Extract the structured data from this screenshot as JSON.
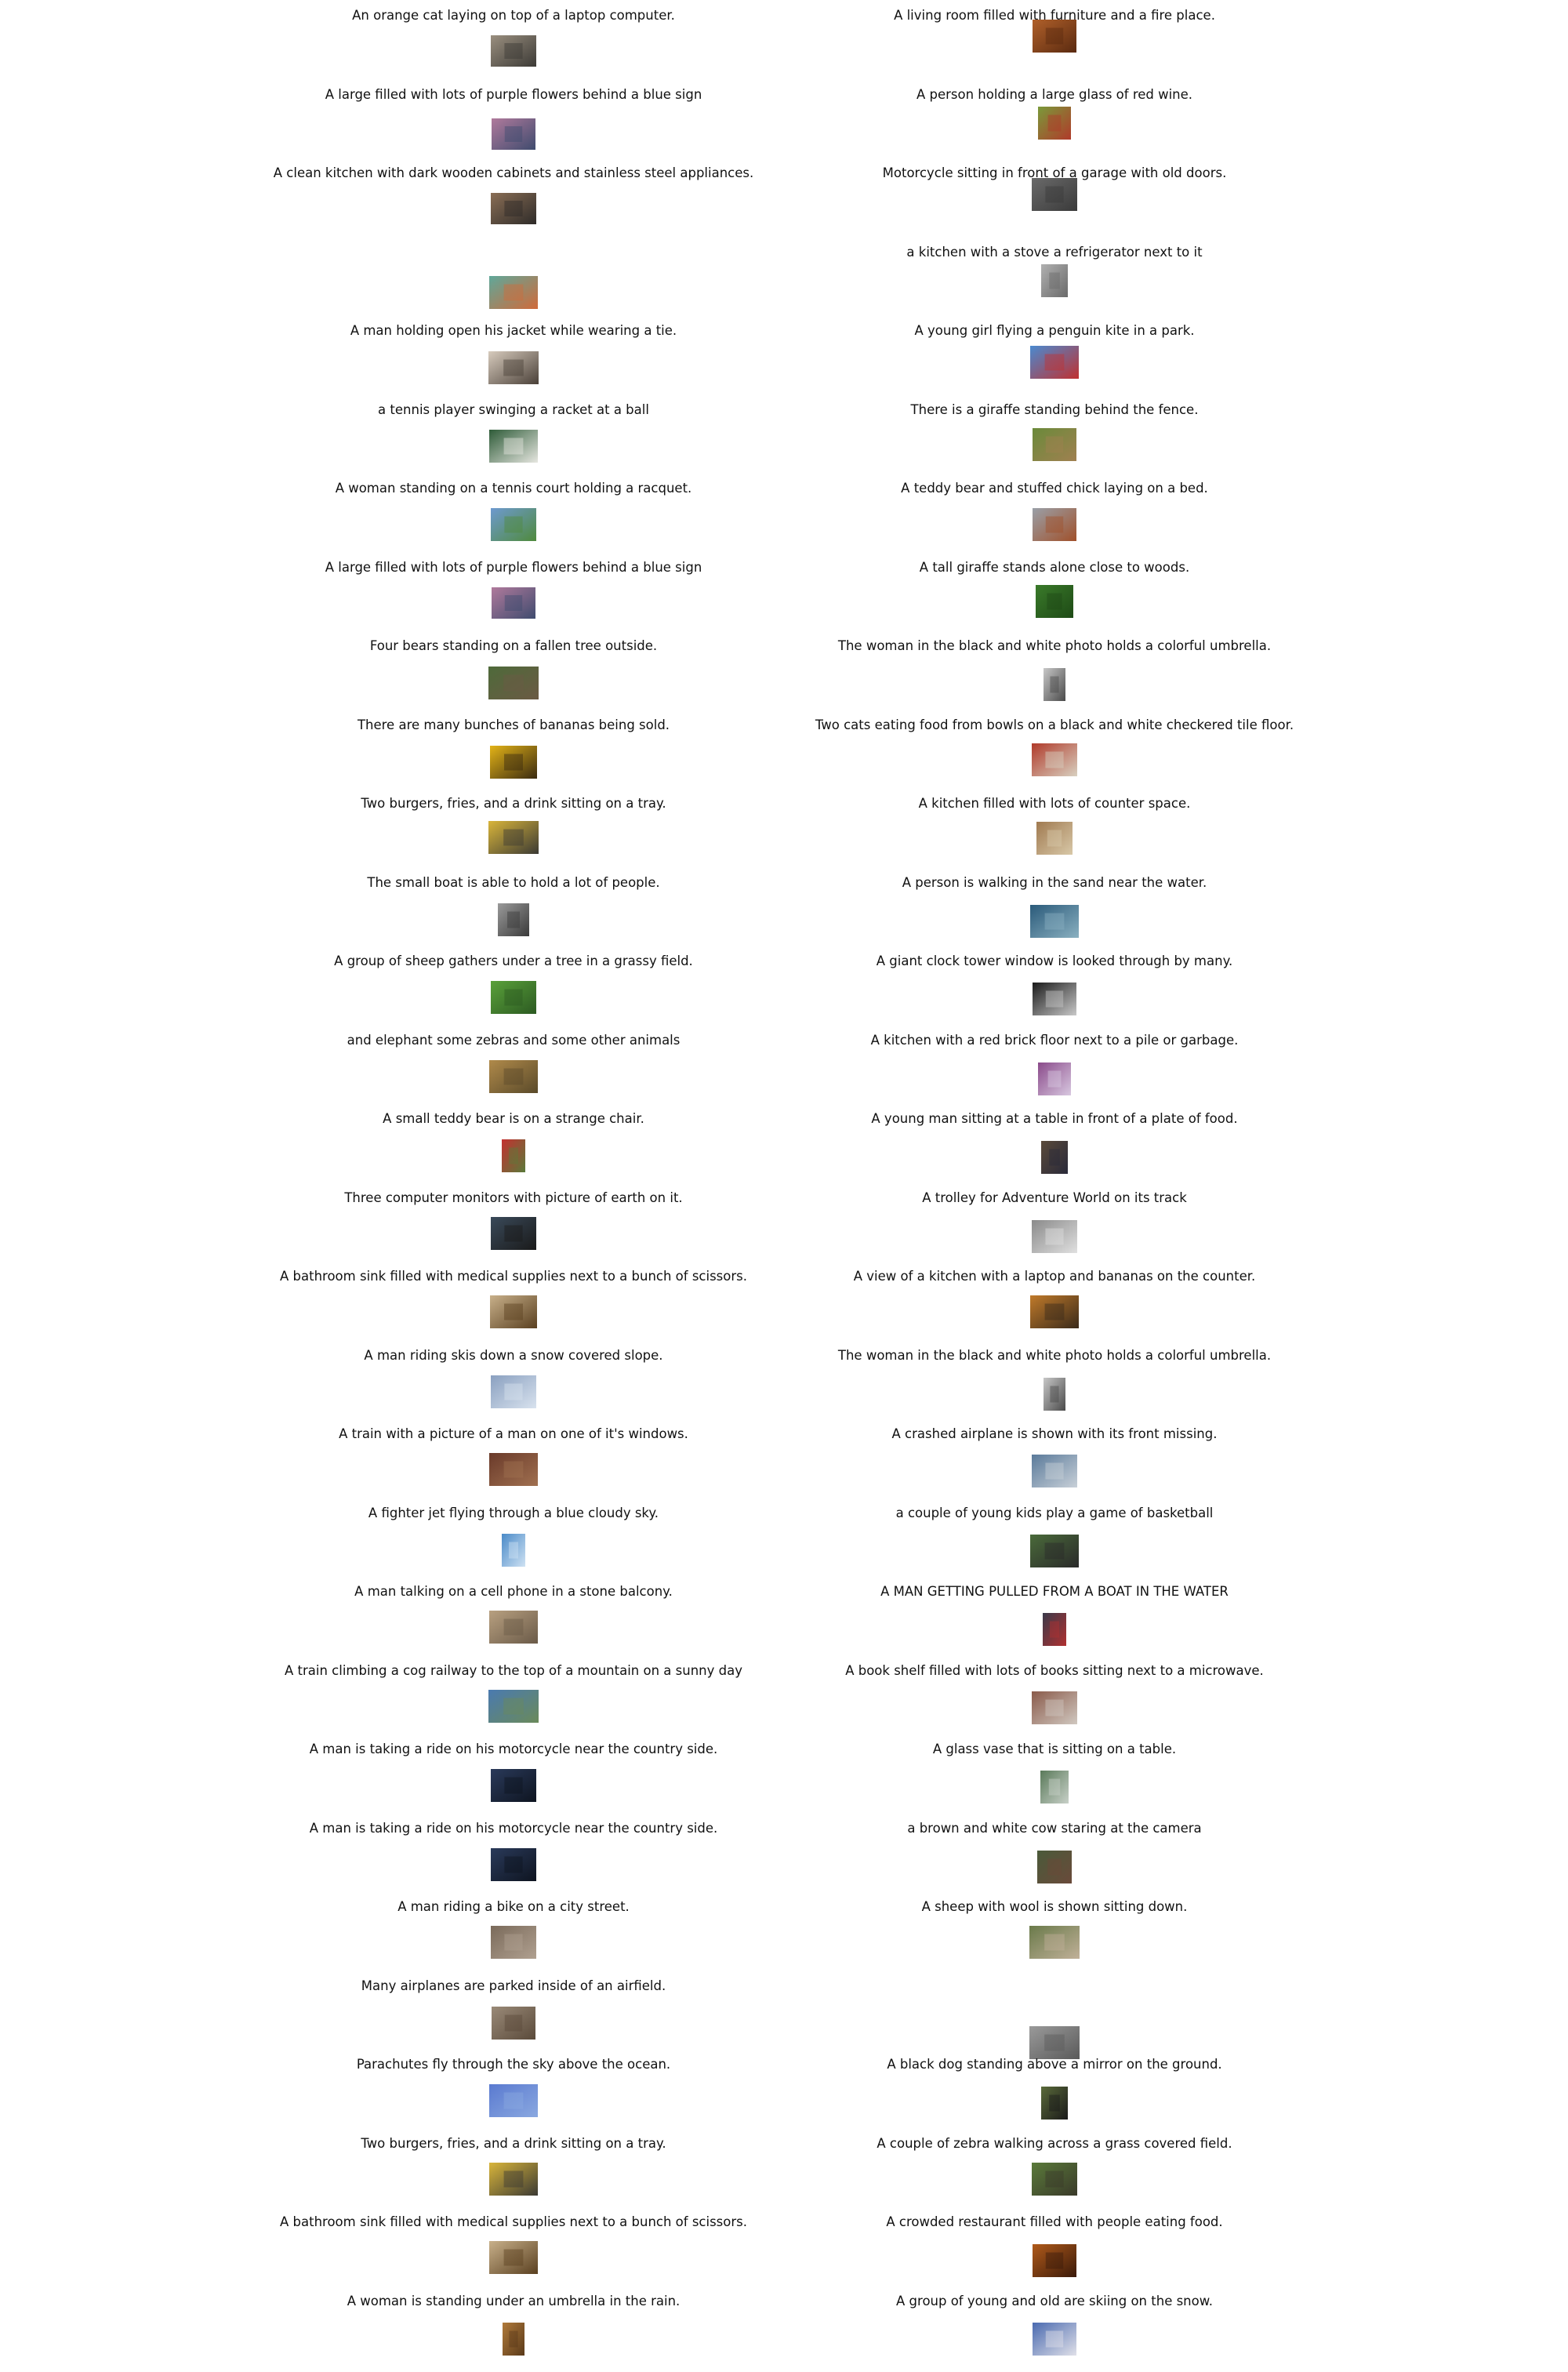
{
  "left_column": [
    {
      "caption": "An orange cat laying on top of a laptop computer.",
      "thumbnail": "cat-on-laptop",
      "colors": [
        "#9a8f7f",
        "#3c3a36"
      ]
    },
    {
      "caption": "A large filled with lots of purple flowers behind a blue sign",
      "thumbnail": "purple-flowers",
      "colors": [
        "#b07a9c",
        "#3f4b6e"
      ]
    },
    {
      "caption": "A clean kitchen with dark wooden cabinets and stainless steel appliances.",
      "thumbnail": "kitchen-cabinets",
      "colors": [
        "#8a6e55",
        "#2e2b29"
      ]
    },
    {
      "caption": "",
      "thumbnail": "person-orange-shirt",
      "colors": [
        "#5fa89a",
        "#d06a3a"
      ]
    },
    {
      "caption": "A man holding open his jacket while wearing a tie.",
      "thumbnail": "man-jacket-tie",
      "colors": [
        "#d7cbbd",
        "#4a4038"
      ]
    },
    {
      "caption": "a tennis player swinging a racket at a ball",
      "thumbnail": "tennis-player",
      "colors": [
        "#2e5b38",
        "#e6e6e0"
      ]
    },
    {
      "caption": "A woman standing on a tennis court holding a racquet.",
      "thumbnail": "woman-tennis-court",
      "colors": [
        "#6e9ad0",
        "#4f8a3c"
      ]
    },
    {
      "caption": "A large filled with lots of purple flowers behind a blue sign",
      "thumbnail": "purple-flowers",
      "colors": [
        "#b07a9c",
        "#3f4b6e"
      ]
    },
    {
      "caption": "Four bears standing on a fallen tree outside.",
      "thumbnail": "bears-on-tree",
      "colors": [
        "#4e6a3a",
        "#6b5a44"
      ]
    },
    {
      "caption": "There are many bunches of bananas being sold.",
      "thumbnail": "bananas",
      "colors": [
        "#e3b317",
        "#3a2a10"
      ]
    },
    {
      "caption": "Two burgers, fries, and a drink sitting on a tray.",
      "thumbnail": "burgers-tray",
      "colors": [
        "#d9b53a",
        "#3b3a34"
      ]
    },
    {
      "caption": "The small boat is able to hold a lot of people.",
      "thumbnail": "small-boat",
      "colors": [
        "#9a9a9a",
        "#3a3a3a"
      ]
    },
    {
      "caption": "A group of sheep gathers under a tree in a grassy field.",
      "thumbnail": "sheep-tree",
      "colors": [
        "#5aa13a",
        "#2c5a22"
      ]
    },
    {
      "caption": "and elephant some zebras and some other animals",
      "thumbnail": "elephant-zebras",
      "colors": [
        "#b08a4a",
        "#5a4a2a"
      ]
    },
    {
      "caption": "A small teddy bear is on a strange chair.",
      "thumbnail": "teddy-bear-chair",
      "colors": [
        "#c43030",
        "#5a7a3a"
      ]
    },
    {
      "caption": "Three computer monitors with picture of earth on it.",
      "thumbnail": "computer-monitors",
      "colors": [
        "#3a4a5a",
        "#1a1a1a"
      ]
    },
    {
      "caption": "A bathroom sink filled with medical supplies next to a bunch of scissors.",
      "thumbnail": "bathroom-sink",
      "colors": [
        "#c8b08a",
        "#5a4020"
      ]
    },
    {
      "caption": "A man riding skis down a snow covered slope.",
      "thumbnail": "man-skiing",
      "colors": [
        "#8aa0c0",
        "#d8e2ee"
      ]
    },
    {
      "caption": "A train with a picture of a man on one of it's windows.",
      "thumbnail": "train-window",
      "colors": [
        "#6a3a2a",
        "#a07050"
      ]
    },
    {
      "caption": "A fighter jet flying through a blue cloudy sky.",
      "thumbnail": "fighter-jet",
      "colors": [
        "#4a8ac8",
        "#cfe2f3"
      ]
    },
    {
      "caption": "A man talking on a cell phone in a stone balcony.",
      "thumbnail": "man-balcony",
      "colors": [
        "#b8a080",
        "#6a5a48"
      ]
    },
    {
      "caption": "A train climbing a cog railway to the top of a mountain on a sunny day",
      "thumbnail": "cog-railway",
      "colors": [
        "#4a7ab0",
        "#6a8a5a"
      ]
    },
    {
      "caption": "A man is taking a ride on his motorcycle near the country side.",
      "thumbnail": "motorcycle-country",
      "colors": [
        "#2a3a5a",
        "#0e1420"
      ]
    },
    {
      "caption": "A man is taking a ride on his motorcycle near the country side.",
      "thumbnail": "motorcycle-country",
      "colors": [
        "#2a3a5a",
        "#0e1420"
      ]
    },
    {
      "caption": "A man riding a bike on a city street.",
      "thumbnail": "bike-city-street",
      "colors": [
        "#7a6a5a",
        "#b0a090"
      ]
    },
    {
      "caption": "Many airplanes are parked inside of an airfield.",
      "thumbnail": "airplanes-airfield",
      "colors": [
        "#9a8a78",
        "#5a4a3a"
      ]
    },
    {
      "caption": "Parachutes fly through the sky above the ocean.",
      "thumbnail": "parachutes",
      "colors": [
        "#5a7ad0",
        "#8aa8e0"
      ]
    },
    {
      "caption": "Two burgers, fries, and a drink sitting on a tray.",
      "thumbnail": "burgers-tray",
      "colors": [
        "#d9b53a",
        "#3b3a34"
      ]
    },
    {
      "caption": "A bathroom sink filled with medical supplies next to a bunch of scissors.",
      "thumbnail": "bathroom-sink",
      "colors": [
        "#c8b08a",
        "#5a4020"
      ]
    },
    {
      "caption": "A woman is standing under an umbrella in the rain.",
      "thumbnail": "umbrella-rain",
      "colors": [
        "#b07a3a",
        "#5a3a1a"
      ]
    }
  ],
  "right_column": [
    {
      "caption": "A living room filled with furniture and a fire place.",
      "thumbnail": "living-room",
      "colors": [
        "#b0602a",
        "#5a2a10"
      ]
    },
    {
      "caption": "A person holding a large glass of red wine.",
      "thumbnail": "glass-red-wine",
      "colors": [
        "#7a9a3a",
        "#b03a2a"
      ]
    },
    {
      "caption": "Motorcycle sitting in front of a garage with old doors.",
      "thumbnail": "motorcycle-garage",
      "colors": [
        "#6a6a6a",
        "#3a3a3a"
      ]
    },
    {
      "caption": "a kitchen with a stove a refrigerator next to it",
      "thumbnail": "kitchen-refrigerator",
      "colors": [
        "#b0b0b0",
        "#6a6a6a"
      ]
    },
    {
      "caption": "A young girl flying a penguin kite in a park.",
      "thumbnail": "girl-penguin-kite",
      "colors": [
        "#4a8ad0",
        "#c03030"
      ]
    },
    {
      "caption": "There is a giraffe standing behind the fence.",
      "thumbnail": "giraffe-fence",
      "colors": [
        "#6a8a3a",
        "#a08050"
      ]
    },
    {
      "caption": "A teddy bear and stuffed chick laying on a bed.",
      "thumbnail": "teddy-bear-bed",
      "colors": [
        "#9aa0a8",
        "#a0502a"
      ]
    },
    {
      "caption": "A tall giraffe stands alone close to woods.",
      "thumbnail": "giraffe-woods",
      "colors": [
        "#3a7a2a",
        "#1e4a16"
      ]
    },
    {
      "caption": "The woman in the black and white photo holds a colorful umbrella.",
      "thumbnail": "bw-umbrella",
      "colors": [
        "#c8c8c8",
        "#4a4a4a"
      ]
    },
    {
      "caption": "Two cats eating food from bowls on a black and white checkered tile floor.",
      "thumbnail": "cats-eating",
      "colors": [
        "#b03a2a",
        "#d8d0c0"
      ]
    },
    {
      "caption": "A kitchen filled with lots of counter space.",
      "thumbnail": "kitchen-counter",
      "colors": [
        "#a07a50",
        "#d8c8a8"
      ]
    },
    {
      "caption": "A person is walking in the sand near the water.",
      "thumbnail": "sand-water",
      "colors": [
        "#2a5a7a",
        "#8ab0c0"
      ]
    },
    {
      "caption": "A giant clock tower window is looked through by many.",
      "thumbnail": "clock-tower-window",
      "colors": [
        "#1a1a1a",
        "#c8c8c8"
      ]
    },
    {
      "caption": "A kitchen with a red brick floor next to a pile or garbage.",
      "thumbnail": "red-brick-kitchen",
      "colors": [
        "#8a4a8a",
        "#d8c8e0"
      ]
    },
    {
      "caption": "A young man sitting at a table in front of a plate of food.",
      "thumbnail": "man-plate-food",
      "colors": [
        "#5a4a3a",
        "#2a2a3a"
      ]
    },
    {
      "caption": "A trolley for Adventure World on its track",
      "thumbnail": "trolley",
      "colors": [
        "#8a8a8a",
        "#e0e0e0"
      ]
    },
    {
      "caption": "A view of a kitchen with a laptop and bananas on the counter.",
      "thumbnail": "kitchen-laptop",
      "colors": [
        "#c07a2a",
        "#3a2a1a"
      ]
    },
    {
      "caption": "The woman in the black and white photo holds a colorful umbrella.",
      "thumbnail": "bw-umbrella",
      "colors": [
        "#c8c8c8",
        "#4a4a4a"
      ]
    },
    {
      "caption": "A crashed airplane is shown with its front missing.",
      "thumbnail": "crashed-airplane",
      "colors": [
        "#5a7a9a",
        "#c8d0d8"
      ]
    },
    {
      "caption": "a couple of young kids play a game of basketball",
      "thumbnail": "kids-basketball",
      "colors": [
        "#4a6a3a",
        "#2a2a2a"
      ]
    },
    {
      "caption": "A MAN GETTING PULLED FROM A BOAT IN THE WATER",
      "thumbnail": "man-boat-water",
      "colors": [
        "#3a3a4a",
        "#b03030"
      ]
    },
    {
      "caption": "A book shelf filled with lots of books sitting next to a microwave.",
      "thumbnail": "book-shelf",
      "colors": [
        "#8a5a4a",
        "#d0c8c0"
      ]
    },
    {
      "caption": "A glass vase that is sitting on a table.",
      "thumbnail": "glass-vase",
      "colors": [
        "#5a7a5a",
        "#c8d0c8"
      ]
    },
    {
      "caption": "a brown and white cow staring at the camera",
      "thumbnail": "brown-white-cow",
      "colors": [
        "#4a5a3a",
        "#6a4a3a"
      ]
    },
    {
      "caption": "A sheep with wool is shown sitting down.",
      "thumbnail": "sheep-sitting",
      "colors": [
        "#6a7a4a",
        "#c0b098"
      ]
    },
    {
      "caption": "",
      "thumbnail": "grey-animal",
      "colors": [
        "#9a9a9a",
        "#5a5a5a"
      ]
    },
    {
      "caption": "A black dog standing above a mirror on the ground.",
      "thumbnail": "black-dog-mirror",
      "colors": [
        "#5a6a3a",
        "#1a1a1a"
      ]
    },
    {
      "caption": "A couple of zebra walking across a grass covered field.",
      "thumbnail": "zebras-field",
      "colors": [
        "#5a7a3a",
        "#3a3a2a"
      ]
    },
    {
      "caption": "A crowded restaurant filled with people eating food.",
      "thumbnail": "crowded-restaurant",
      "colors": [
        "#b05a1a",
        "#3a1a0a"
      ]
    },
    {
      "caption": "A group of young and old are skiing on the snow.",
      "thumbnail": "group-skiing",
      "colors": [
        "#4a6ab0",
        "#e0e0e8"
      ]
    }
  ]
}
